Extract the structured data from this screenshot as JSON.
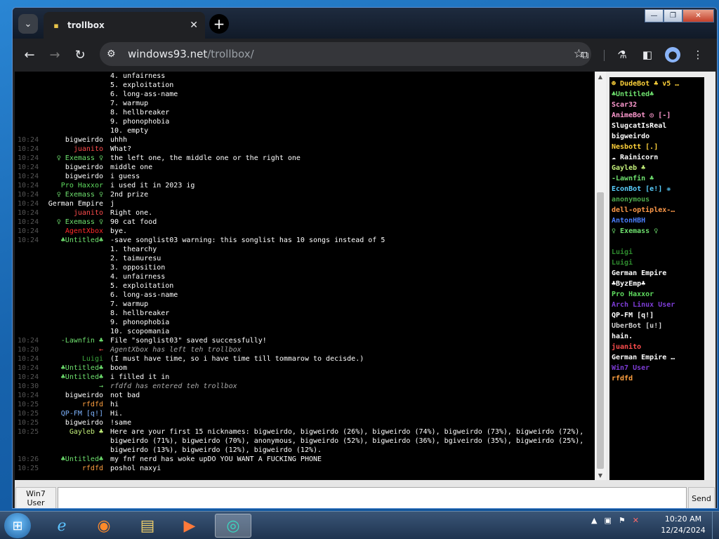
{
  "browser": {
    "tab_title": "trollbox",
    "url_domain": "windows93.net",
    "url_path": "/trollbox/",
    "new_tab_label": "+",
    "close_label": "✕"
  },
  "messages": [
    {
      "time": "",
      "nick": "",
      "nick_color": "#fff",
      "text": "4. unfairness"
    },
    {
      "time": "",
      "nick": "",
      "nick_color": "#fff",
      "text": "5. exploitation"
    },
    {
      "time": "",
      "nick": "",
      "nick_color": "#fff",
      "text": "6. long-ass-name"
    },
    {
      "time": "",
      "nick": "",
      "nick_color": "#fff",
      "text": "7. warmup"
    },
    {
      "time": "",
      "nick": "",
      "nick_color": "#fff",
      "text": "8. hellbreaker"
    },
    {
      "time": "",
      "nick": "",
      "nick_color": "#fff",
      "text": "9. phonophobia"
    },
    {
      "time": "",
      "nick": "",
      "nick_color": "#fff",
      "text": "10. empty"
    },
    {
      "time": "10:24",
      "nick": "bigweirdo",
      "nick_color": "#ffffff",
      "text": "uhhh"
    },
    {
      "time": "10:24",
      "nick": "juanito",
      "nick_color": "#ff4d4d",
      "text": "What?"
    },
    {
      "time": "10:24",
      "nick": "♀ Exemass ♀",
      "nick_color": "#6ee06e",
      "text": "the left one, the middle one or the right one"
    },
    {
      "time": "10:24",
      "nick": "bigweirdo",
      "nick_color": "#ffffff",
      "text": "middle one"
    },
    {
      "time": "10:24",
      "nick": "bigweirdo",
      "nick_color": "#ffffff",
      "text": "i guess"
    },
    {
      "time": "10:24",
      "nick": "Pro Haxxor",
      "nick_color": "#5fdc5f",
      "text": "i used it in 2023 ig"
    },
    {
      "time": "10:24",
      "nick": "♀ Exemass ♀",
      "nick_color": "#6ee06e",
      "text": "2nd prize"
    },
    {
      "time": "10:24",
      "nick": "German Empire",
      "nick_color": "#ffffff",
      "text": "j"
    },
    {
      "time": "10:24",
      "nick": "juanito",
      "nick_color": "#ff4d4d",
      "text": "Right one."
    },
    {
      "time": "10:24",
      "nick": "♀ Exemass ♀",
      "nick_color": "#6ee06e",
      "text": "90 cat food"
    },
    {
      "time": "10:24",
      "nick": "AgentXbox",
      "nick_color": "#ff2a2a",
      "text": "bye."
    },
    {
      "time": "10:24",
      "nick": "♣Untitled♣",
      "nick_color": "#6ee06e",
      "text": "-save songlist03 warning: this songlist has 10 songs instead of 5"
    },
    {
      "time": "",
      "nick": "",
      "nick_color": "#fff",
      "text": "1. thearchy"
    },
    {
      "time": "",
      "nick": "",
      "nick_color": "#fff",
      "text": "2. taimuresu"
    },
    {
      "time": "",
      "nick": "",
      "nick_color": "#fff",
      "text": "3. opposition"
    },
    {
      "time": "",
      "nick": "",
      "nick_color": "#fff",
      "text": "4. unfairness"
    },
    {
      "time": "",
      "nick": "",
      "nick_color": "#fff",
      "text": "5. exploitation"
    },
    {
      "time": "",
      "nick": "",
      "nick_color": "#fff",
      "text": "6. long-ass-name"
    },
    {
      "time": "",
      "nick": "",
      "nick_color": "#fff",
      "text": "7. warmup"
    },
    {
      "time": "",
      "nick": "",
      "nick_color": "#fff",
      "text": "8. hellbreaker"
    },
    {
      "time": "",
      "nick": "",
      "nick_color": "#fff",
      "text": "9. phonophobia"
    },
    {
      "time": "",
      "nick": "",
      "nick_color": "#fff",
      "text": "10. scopomania"
    },
    {
      "time": "10:24",
      "nick": "-Lawnfin ♣",
      "nick_color": "#6ee06e",
      "text": "File \"songlist03\" saved successfully!"
    },
    {
      "time": "10:20",
      "nick": "←",
      "nick_color": "#ff4d4d",
      "text": "AgentXbox has left teh trollbox",
      "italic": true
    },
    {
      "time": "10:24",
      "nick": "Luigi",
      "nick_color": "#3da83d",
      "text": "(I must have time, so i have time till tommarow to decisde.)"
    },
    {
      "time": "10:24",
      "nick": "♣Untitled♣",
      "nick_color": "#6ee06e",
      "text": "boom"
    },
    {
      "time": "10:24",
      "nick": "♣Untitled♣",
      "nick_color": "#6ee06e",
      "text": "i filled it in"
    },
    {
      "time": "10:30",
      "nick": "→",
      "nick_color": "#6ee06e",
      "text": "rfdfd has entered teh trollbox",
      "italic": true
    },
    {
      "time": "10:24",
      "nick": "bigweirdo",
      "nick_color": "#ffffff",
      "text": "not bad"
    },
    {
      "time": "10:25",
      "nick": "rfdfd",
      "nick_color": "#ffa040",
      "text": "hi"
    },
    {
      "time": "10:25",
      "nick": "QP-FM [q!]",
      "nick_color": "#7fb4ff",
      "text": "Hi."
    },
    {
      "time": "10:25",
      "nick": "bigweirdo",
      "nick_color": "#ffffff",
      "text": "!same"
    },
    {
      "time": "10:25",
      "nick": "Gayleb ♣",
      "nick_color": "#c4f07a",
      "text": "Here are your first 15 nicknames: bigweirdo, bigweirdo (26%), bigweirdo (74%), bigweirdo (73%), bigweirdo (72%), bigweirdo (71%), bigweirdo (70%), anonymous, bigweirdo (52%), bigweirdo (36%), bgiveirdo (35%), bigweirdo (25%), bigweirdo (13%), bigweirdo (12%), bigweirdo (12%)."
    },
    {
      "time": "10:26",
      "nick": "♣Untitled♣",
      "nick_color": "#6ee06e",
      "text": "my fnf nerd has woke upDO YOU WANT A FUCKING PHONE"
    },
    {
      "time": "10:25",
      "nick": "rfdfd",
      "nick_color": "#ffa040",
      "text": "poshol naxyi"
    }
  ],
  "users": [
    {
      "name": "☻ DudeBot ♣ v5 …",
      "color": "#ffd23a"
    },
    {
      "name": "♣Untitled♣",
      "color": "#6ee06e"
    },
    {
      "name": "Scar32",
      "color": "#ff9ad0"
    },
    {
      "name": "AnimeBot ◎ [-]",
      "color": "#ff9ad0"
    },
    {
      "name": "SlugcatIsReal",
      "color": "#ffffff"
    },
    {
      "name": "bigweirdo",
      "color": "#ffffff"
    },
    {
      "name": "Nesbott [.]",
      "color": "#ffd23a"
    },
    {
      "name": "☁ Rainicorn",
      "color": "#ffffff"
    },
    {
      "name": "Gayleb ♣",
      "color": "#c4f07a"
    },
    {
      "name": "-Lawnfin ♣",
      "color": "#6ee06e"
    },
    {
      "name": "EconBot [e!] ❋",
      "color": "#5ad0ff"
    },
    {
      "name": "anonymous",
      "color": "#4ca84c"
    },
    {
      "name": "dell-optiplex-…",
      "color": "#ff9a4a"
    },
    {
      "name": "AntonHBH",
      "color": "#4a7fff"
    },
    {
      "name": "♀ Exemass ♀",
      "color": "#6ee06e"
    },
    {
      "name": "",
      "color": "#3a2a6e"
    },
    {
      "name": "Luigi",
      "color": "#2e8a2e"
    },
    {
      "name": "Luigi",
      "color": "#2e8a2e"
    },
    {
      "name": "German Empire",
      "color": "#ffffff"
    },
    {
      "name": "♣ByzEmp♣",
      "color": "#ffffff"
    },
    {
      "name": "Pro Haxxor",
      "color": "#5fdc5f"
    },
    {
      "name": "Arch Linux User",
      "color": "#7d3cd6"
    },
    {
      "name": "QP-FM [q!]",
      "color": "#ffffff"
    },
    {
      "name": "UberBot [u!]",
      "color": "#cfcfcf"
    },
    {
      "name": "hain.",
      "color": "#ffffff"
    },
    {
      "name": "juanito",
      "color": "#ff4d4d"
    },
    {
      "name": "German Empire …",
      "color": "#ffffff"
    },
    {
      "name": "Win7 User",
      "color": "#7d3cd6"
    },
    {
      "name": "rfdfd",
      "color": "#ffa040"
    }
  ],
  "input": {
    "user_line1": "Win7",
    "user_line2": "User",
    "send_label": "Send",
    "message_value": ""
  },
  "taskbar": {
    "time": "10:20 AM",
    "date": "12/24/2024"
  }
}
